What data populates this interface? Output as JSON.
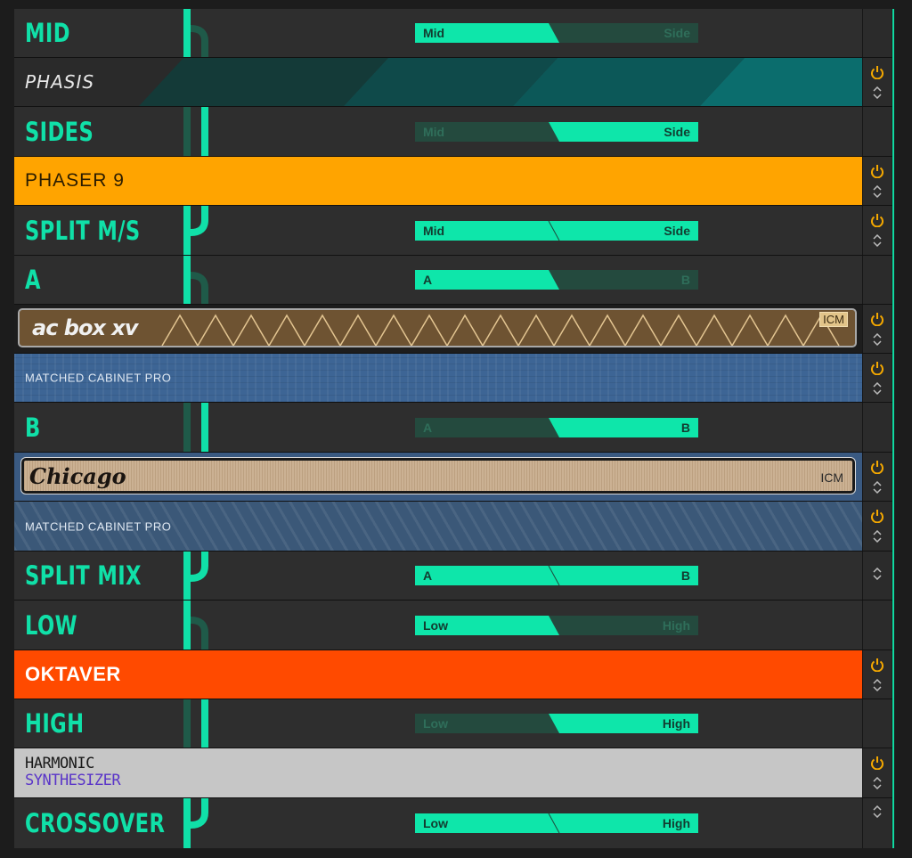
{
  "colors": {
    "accent": "#10e0a8",
    "power": "#f4a800",
    "phaser_bg": "#ffa400",
    "oktaver_bg": "#ff4a00",
    "cabinet_bg": "#3d6595",
    "harmonic_bg": "#c6c6c6"
  },
  "rows": {
    "mid": {
      "label": "MID",
      "left": "Mid",
      "right": "Side"
    },
    "phasis": {
      "title": "PHASIS"
    },
    "sides": {
      "label": "SIDES",
      "left": "Mid",
      "right": "Side"
    },
    "phaser9": {
      "title": "PHASER 9"
    },
    "split_ms": {
      "label": "SPLIT M/S",
      "left": "Mid",
      "right": "Side"
    },
    "a": {
      "label": "A",
      "left": "A",
      "right": "B"
    },
    "acbox": {
      "title": "ac box xv",
      "badge": "ICM"
    },
    "cab1": {
      "title": "MATCHED CABINET PRO"
    },
    "b": {
      "label": "B",
      "left": "A",
      "right": "B"
    },
    "chicago": {
      "title": "Chicago",
      "badge": "ICM"
    },
    "cab2": {
      "title": "MATCHED CABINET PRO"
    },
    "split_mix": {
      "label": "SPLIT MIX",
      "left": "A",
      "right": "B"
    },
    "low": {
      "label": "LOW",
      "left": "Low",
      "right": "High"
    },
    "oktaver": {
      "title": "OKTAVER"
    },
    "high": {
      "label": "HIGH",
      "left": "Low",
      "right": "High"
    },
    "harmonic": {
      "title_line1": "HARMONIC",
      "title_line2": "SYNTHESIZER"
    },
    "crossover": {
      "label": "CROSSOVER",
      "left": "Low",
      "right": "High"
    }
  }
}
